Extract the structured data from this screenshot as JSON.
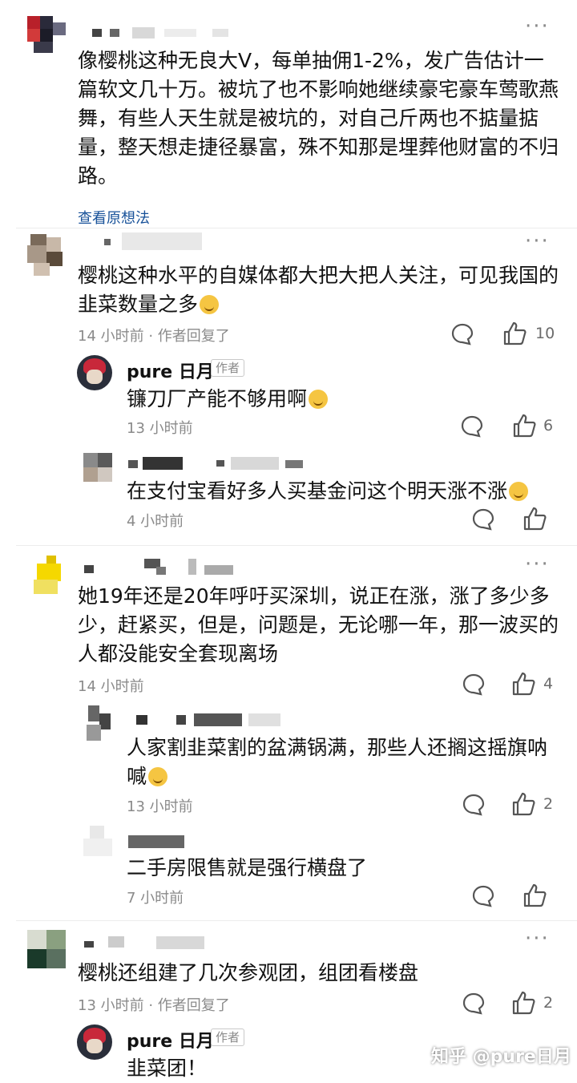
{
  "comments": {
    "c1": {
      "text": "像樱桃这种无良大V，每单抽佣1-2%，发广告估计一篇软文几十万。被坑了也不影响她继续豪宅豪车莺歌燕舞，有些人天生就是被坑的，对自己斤两也不掂量掂量，整天想走捷径暴富，殊不知那是埋葬他财富的不归路。",
      "view_thoughts": "查看原想法"
    },
    "c2": {
      "text": "樱桃这种水平的自媒体都大把大把人关注，可见我国的韭菜数量之多",
      "meta": "14 小时前 · 作者回复了",
      "likes": "10"
    },
    "r2a": {
      "name": "pure 日月",
      "tag": "作者",
      "text": "镰刀厂产能不够用啊",
      "meta": "13 小时前",
      "likes": "6"
    },
    "r2b": {
      "text": "在支付宝看好多人买基金问这个明天涨不涨",
      "meta": "4 小时前"
    },
    "c3": {
      "text": "她19年还是20年呼吁买深圳，说正在涨，涨了多少多少，赶紧买，但是，问题是，无论哪一年，那一波买的人都没能安全套现离场",
      "meta": "14 小时前",
      "likes": "4"
    },
    "r3a": {
      "text": "人家割韭菜割的盆满锅满，那些人还搁这摇旗呐喊",
      "meta": "13 小时前",
      "likes": "2"
    },
    "r3b": {
      "text": "二手房限售就是强行横盘了",
      "meta": "7 小时前"
    },
    "c4": {
      "text": "樱桃还组建了几次参观团，组团看楼盘",
      "meta": "13 小时前 · 作者回复了",
      "likes": "2"
    },
    "r4a": {
      "name": "pure 日月",
      "tag": "作者",
      "text": "韭菜团！"
    }
  },
  "more_label": "···",
  "watermark": "知乎 @pure日月",
  "colors": {
    "link": "#175199",
    "meta": "#8a8a8a"
  }
}
